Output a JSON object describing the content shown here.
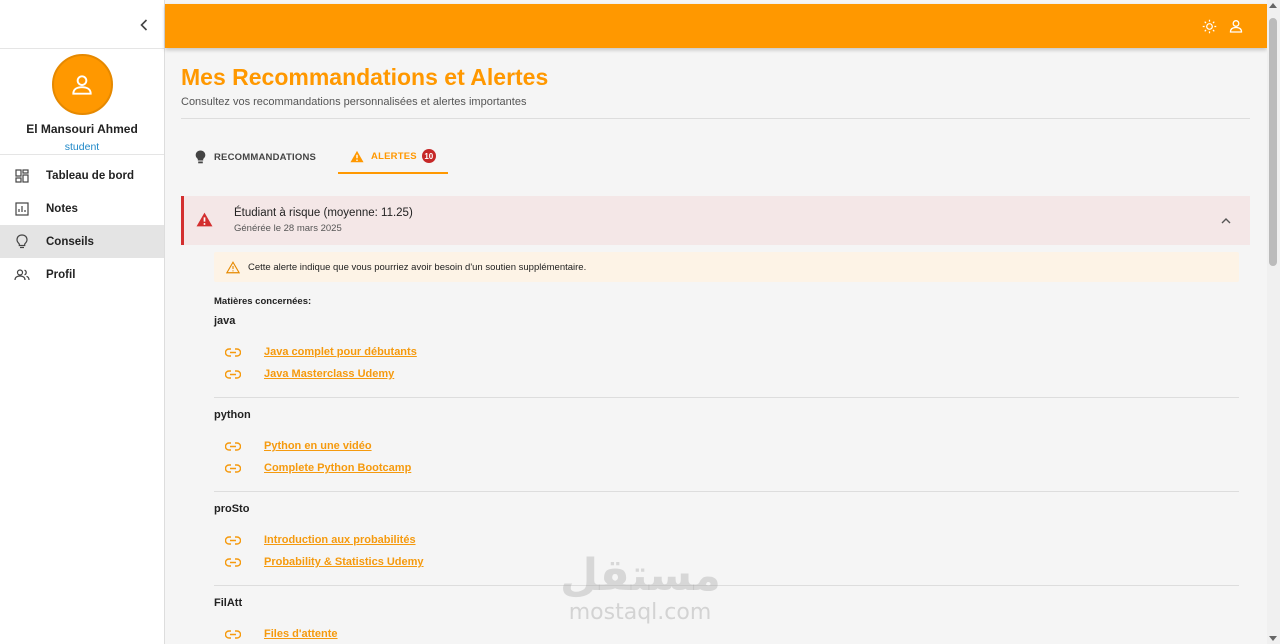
{
  "sidebar": {
    "user_name": "El Mansouri Ahmed",
    "user_role": "student",
    "items": [
      {
        "label": "Tableau de bord",
        "icon": "dashboard-icon",
        "active": false
      },
      {
        "label": "Notes",
        "icon": "chart-icon",
        "active": false
      },
      {
        "label": "Conseils",
        "icon": "lightbulb-icon",
        "active": true
      },
      {
        "label": "Profil",
        "icon": "people-icon",
        "active": false
      }
    ]
  },
  "topbar": {
    "color": "#ff9800",
    "icons": [
      "sun-icon",
      "account-icon"
    ]
  },
  "page": {
    "title": "Mes Recommandations et Alertes",
    "subtitle": "Consultez vos recommandations personnalisées et alertes importantes"
  },
  "tabs": [
    {
      "label": "RECOMMANDATIONS",
      "icon": "lightbulb-icon",
      "active": false
    },
    {
      "label": "ALERTES",
      "icon": "warning-icon",
      "active": true,
      "badge": "10"
    }
  ],
  "alert": {
    "title": "Étudiant à risque (moyenne: 11.25)",
    "date": "Générée le 28 mars 2025",
    "warning": "Cette alerte indique que vous pourriez avoir besoin d'un soutien supplémentaire.",
    "subjects_label": "Matières concernées:",
    "subjects": [
      {
        "name": "java",
        "links": [
          "Java complet pour débutants",
          "Java Masterclass Udemy"
        ]
      },
      {
        "name": "python",
        "links": [
          "Python en une vidéo",
          "Complete Python Bootcamp"
        ]
      },
      {
        "name": "proSto",
        "links": [
          "Introduction aux probabilités",
          "Probability & Statistics Udemy"
        ]
      },
      {
        "name": "FilAtt",
        "links": [
          "Files d'attente"
        ]
      }
    ]
  },
  "watermark": {
    "logo": "مستقل",
    "text": "mostaql.com"
  },
  "colors": {
    "accent": "#ff9800",
    "alert_red": "#d32f2f",
    "link": "#f59a0e",
    "role": "#1e88c8"
  }
}
